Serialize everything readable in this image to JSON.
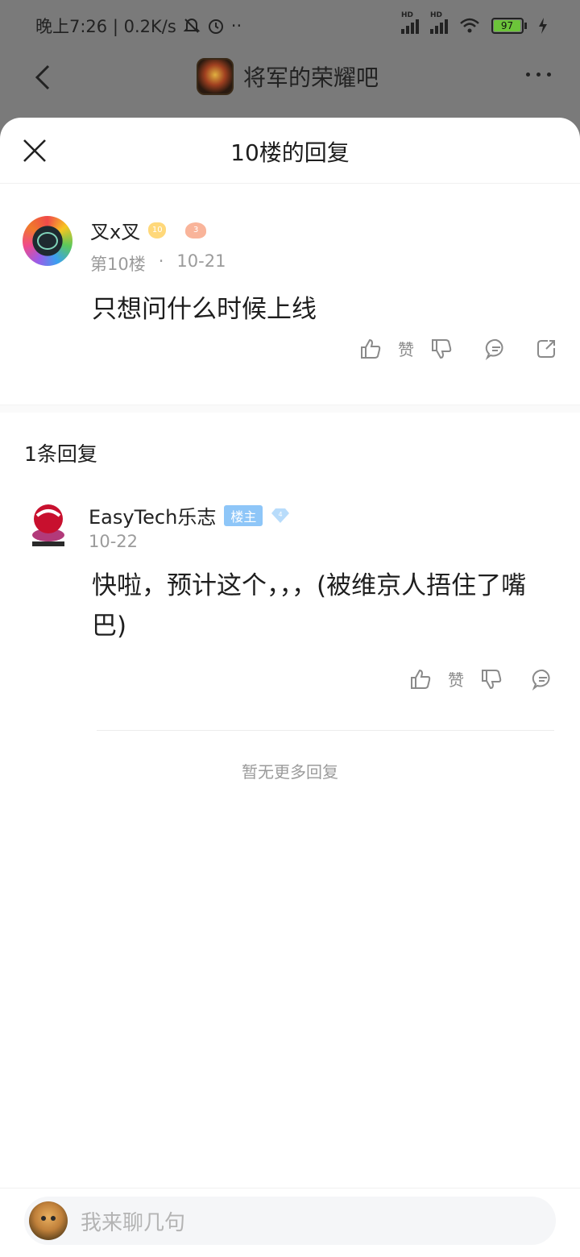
{
  "status_bar": {
    "time_network": "晚上7:26 | 0.2K/s",
    "signal_label_1": "HD",
    "signal_label_2": "HD",
    "battery": "97"
  },
  "app_bar": {
    "forum_name": "将军的荣耀吧"
  },
  "sheet": {
    "title": "10楼的回复"
  },
  "floor_post": {
    "author": "叉x叉",
    "level_badge": "10",
    "fan_badge": "3",
    "floor_label": "第10楼",
    "dot": "·",
    "date": "10-21",
    "content": "只想问什么时候上线",
    "like_label": "赞"
  },
  "replies": {
    "count_label": "1条回复",
    "items": [
      {
        "author": "EasyTech乐志",
        "owner_tag": "楼主",
        "level_badge": "4",
        "date": "10-22",
        "content": "快啦，预计这个，，，(被维京人捂住了嘴巴)",
        "like_label": "赞"
      }
    ],
    "end_label": "暂无更多回复"
  },
  "composer": {
    "placeholder": "我来聊几句"
  }
}
